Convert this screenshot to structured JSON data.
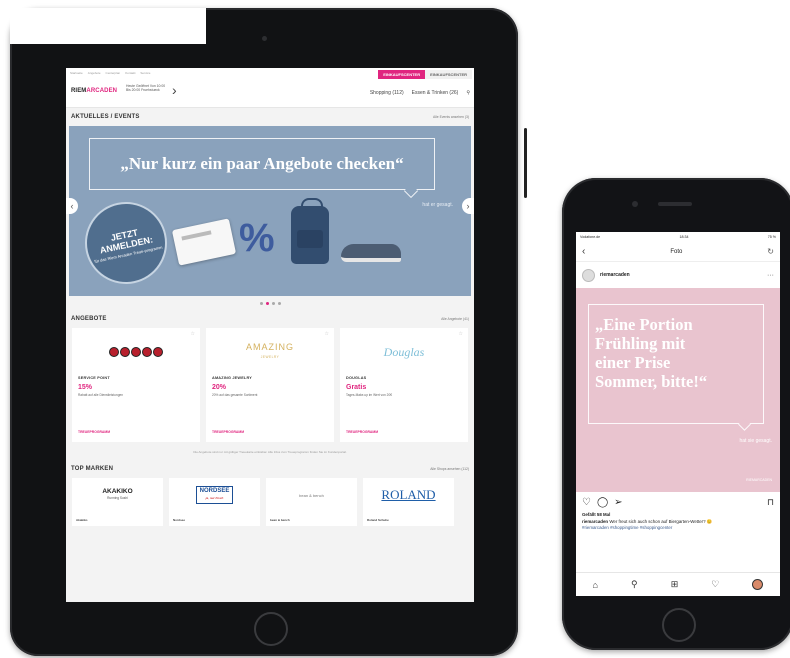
{
  "tablet": {
    "toplinks": [
      "Startseite",
      "Angebote",
      "Centerplan",
      "Kontakt",
      "Service"
    ],
    "toptabs": [
      "EINKAUFSCENTER",
      "EINKAUFSCENTER"
    ],
    "logo_left": "RIEM",
    "logo_accent": "ARCADEN",
    "hours": "Heute Geöffnet Von 10:00 Bis 20:00 Fruehstueck",
    "nav": [
      "Shopping (112)",
      "Essen & Trinken (26)"
    ],
    "events": {
      "title": "AKTUELLES / EVENTS",
      "link": "Alle Events ansehen (3)",
      "quote": "„Nur kurz ein paar Angebote checken“",
      "said": "hat er gesagt.",
      "circle_big": "JETZT ANMELDEN:",
      "circle_small": "für das Riem Arcaden Treue-programm"
    },
    "offers": {
      "title": "ANGEBOTE",
      "link": "Alle Angebote (41)",
      "items": [
        {
          "brand": "SERVICE POINT",
          "value": "15%",
          "desc": "Rabatt auf alle Dienstleistungen",
          "prog": "TREUEPROGRAMM"
        },
        {
          "brand": "AMAZING JEWELRY",
          "value": "20%",
          "desc": "20% auf das gesamte Sortiment",
          "prog": "TREUEPROGRAMM"
        },
        {
          "brand": "DOUGLAS",
          "value": "Gratis",
          "desc": "Tages-Make-up im Wert von 20€",
          "prog": "TREUEPROGRAMM"
        }
      ],
      "amazing_logo": "AMAZING",
      "amazing_sub": "JEWELRY",
      "douglas_logo": "Douglas",
      "disclaimer": "Die Angebote sind nur mit gültiger Treuekarte einlösbar. Alle Infos zum Treueprogramm finden Sie im Kundenportal."
    },
    "brands": {
      "title": "TOP MARKEN",
      "link": "Alle Shops ansehen (112)",
      "items": [
        {
          "name": "AKAKIKO",
          "sub": "Running Sushi",
          "label": "Akakiko"
        },
        {
          "name": "NORDSEE",
          "sub": "ja, nur Fisch",
          "label": "Nordsee"
        },
        {
          "name": "bean & bench",
          "sub": "",
          "label": "bean & bench"
        },
        {
          "name": "ROLAND",
          "sub": "",
          "label": "Roland Schuhe"
        }
      ]
    }
  },
  "phone": {
    "carrier": "Vodafone.de",
    "time": "18:34",
    "battery": "75 %",
    "title": "Foto",
    "username": "riemarcaden",
    "quote": "„Eine Portion\nFrühling mit\neiner Prise\nSommer, bitte!“",
    "said": "hat sie gesagt.",
    "photo_logo": "RIEMARCADEN",
    "likes": "Gefällt 58 Mal",
    "caption_user": "riemarcaden",
    "caption_text": " Wer freut sich auch schon auf Biergarten-Wetter? 😊",
    "tags": "#riemarcaden #shoppingtime #shoppingcenter"
  },
  "icons": [
    "chevron-right-icon",
    "search-icon",
    "star-icon",
    "arrow-left-icon",
    "arrow-right-icon",
    "back-icon",
    "refresh-icon",
    "more-icon",
    "heart-icon",
    "comment-icon",
    "send-icon",
    "bookmark-icon",
    "home-icon",
    "plus-icon",
    "profile-icon"
  ],
  "colors": {
    "accent": "#e0257f",
    "hero_bg": "#8aa2bc",
    "photo_bg": "#e9c4cf",
    "device": "#121316"
  }
}
